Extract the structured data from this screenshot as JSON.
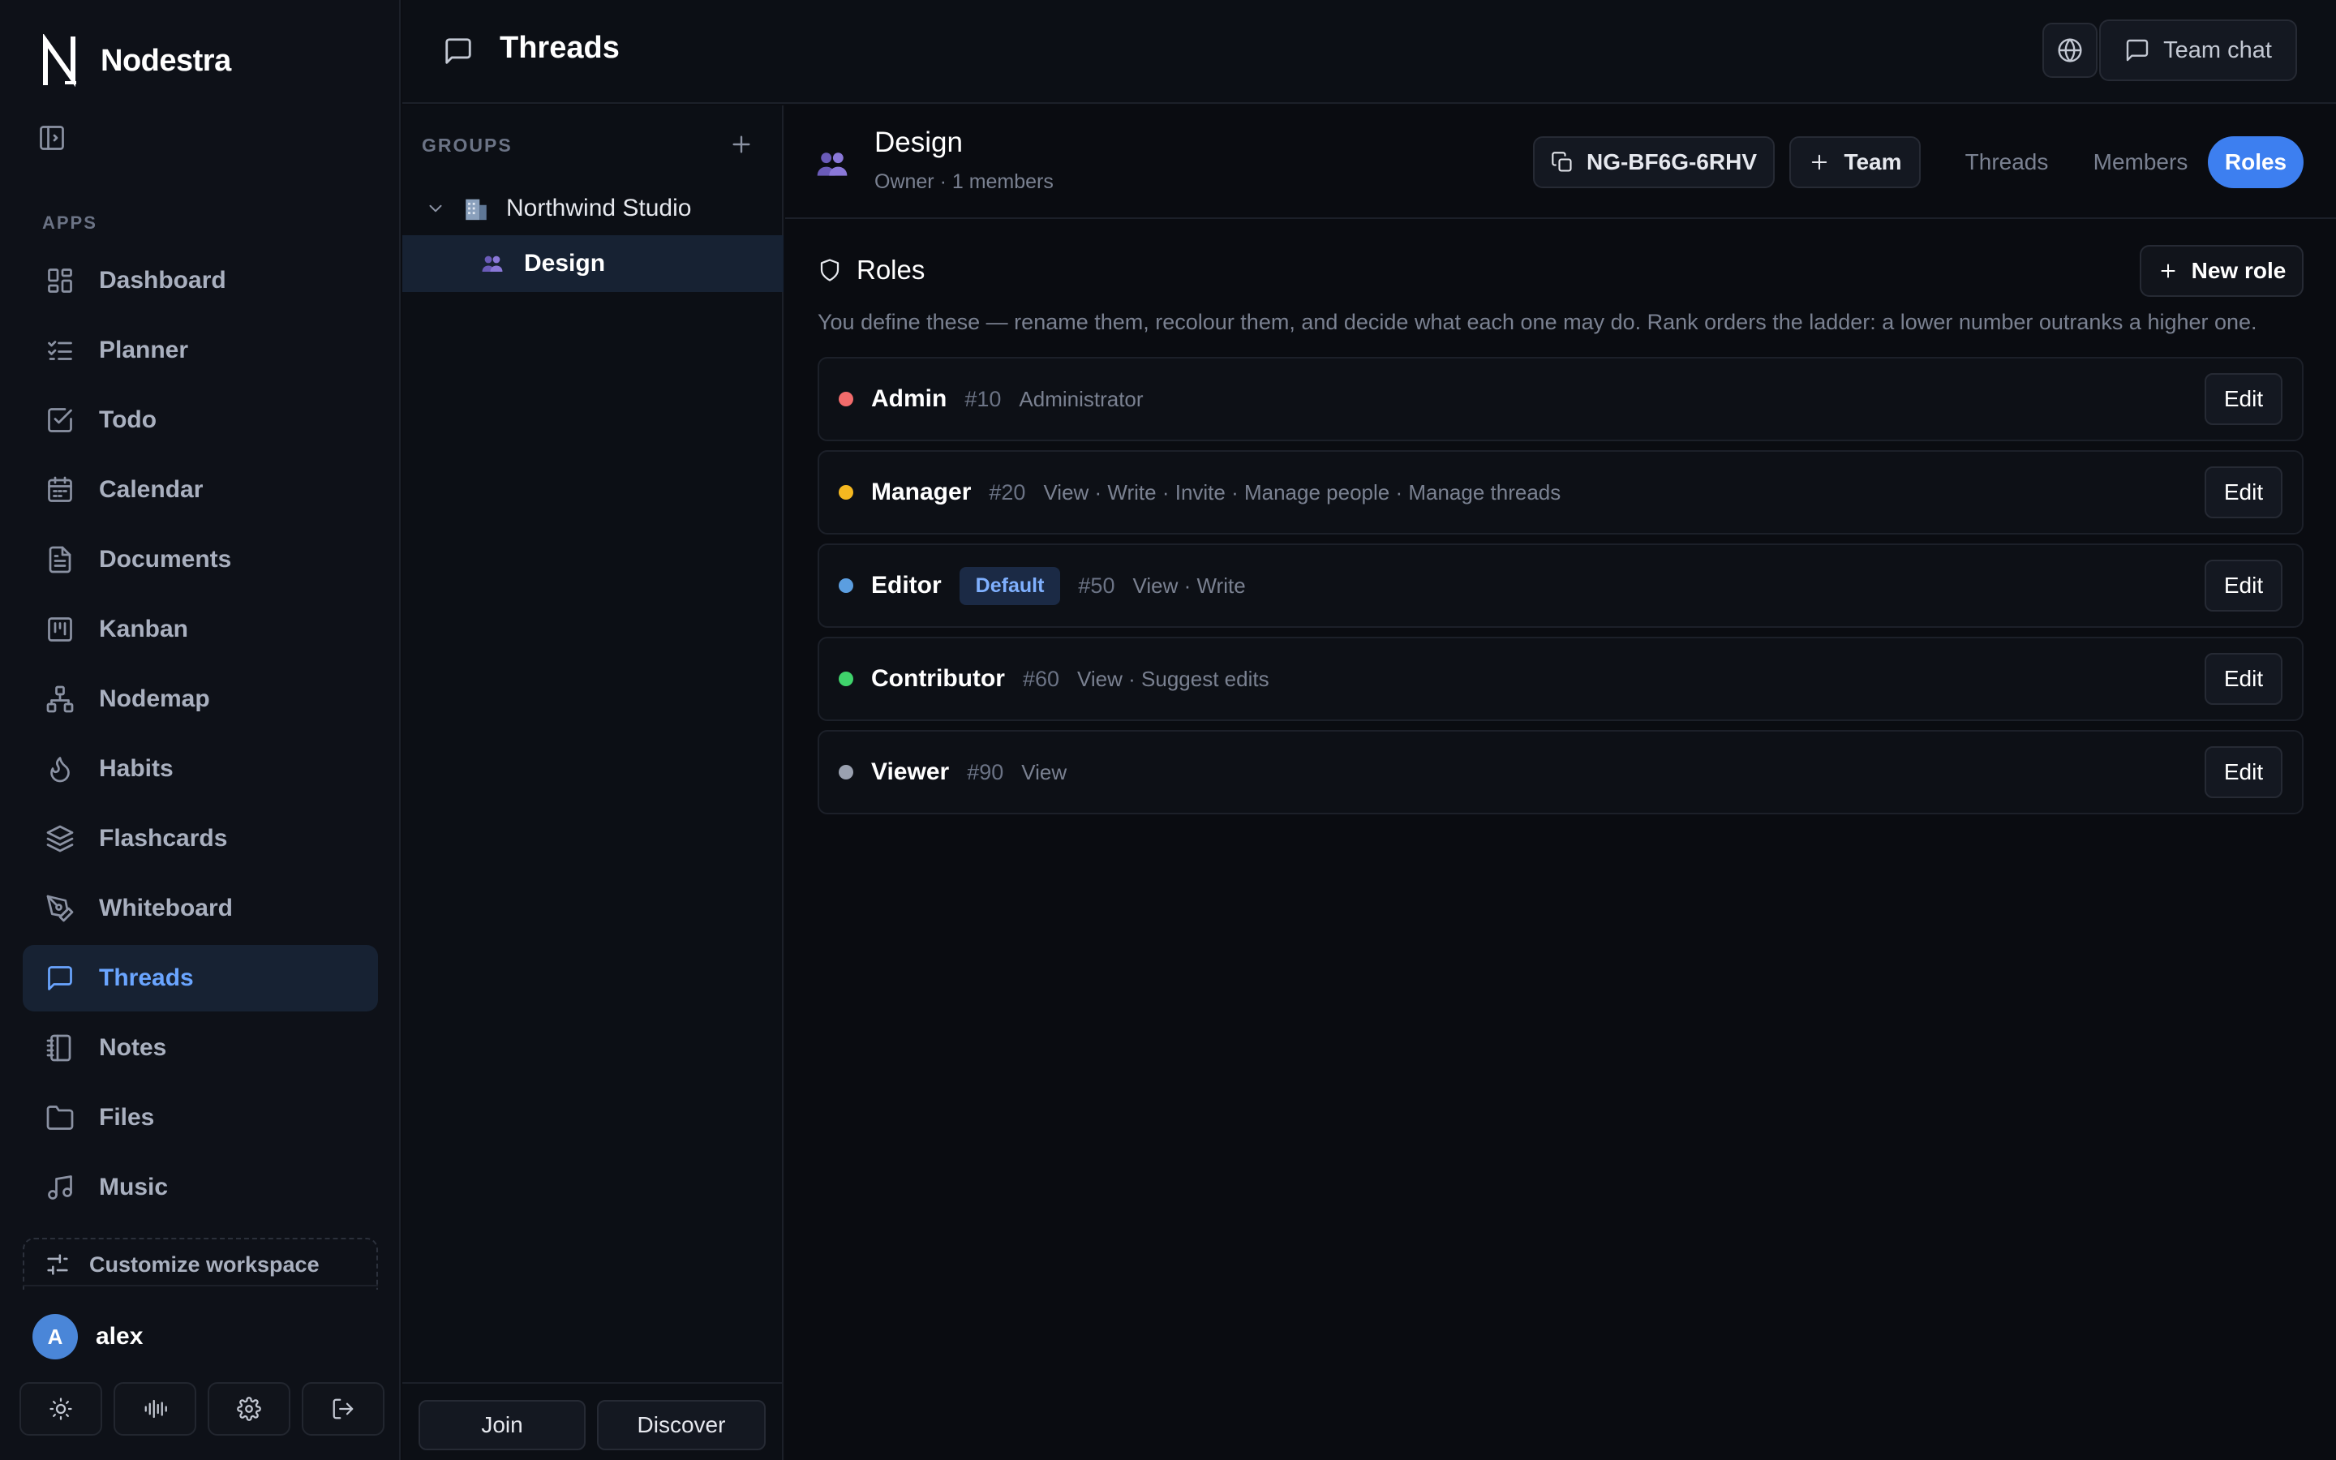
{
  "app": {
    "name": "Nodestra"
  },
  "sidebar": {
    "section_label": "APPS",
    "items": [
      {
        "label": "Dashboard",
        "icon": "dashboard-icon"
      },
      {
        "label": "Planner",
        "icon": "list-check-icon"
      },
      {
        "label": "Todo",
        "icon": "checkbox-icon"
      },
      {
        "label": "Calendar",
        "icon": "calendar-icon"
      },
      {
        "label": "Documents",
        "icon": "document-icon"
      },
      {
        "label": "Kanban",
        "icon": "kanban-icon"
      },
      {
        "label": "Nodemap",
        "icon": "nodemap-icon"
      },
      {
        "label": "Habits",
        "icon": "flame-icon"
      },
      {
        "label": "Flashcards",
        "icon": "layers-icon"
      },
      {
        "label": "Whiteboard",
        "icon": "pen-tool-icon"
      },
      {
        "label": "Threads",
        "icon": "message-icon",
        "active": true
      },
      {
        "label": "Notes",
        "icon": "notebook-icon"
      },
      {
        "label": "Files",
        "icon": "folder-icon"
      },
      {
        "label": "Music",
        "icon": "music-icon"
      }
    ],
    "customize_label": "Customize workspace",
    "user": {
      "initial": "A",
      "name": "alex"
    },
    "footer_buttons": [
      "sun-icon",
      "audio-waveform-icon",
      "gear-icon",
      "logout-icon"
    ]
  },
  "topbar": {
    "title": "Threads",
    "team_chat_label": "Team chat"
  },
  "groups": {
    "label": "GROUPS",
    "org": "Northwind Studio",
    "group": "Design",
    "join_label": "Join",
    "discover_label": "Discover"
  },
  "group_header": {
    "name": "Design",
    "subtitle": "Owner · 1 members",
    "invite_code": "NG-BF6G-6RHV",
    "team_label": "Team",
    "tabs": [
      "Threads",
      "Members",
      "Roles"
    ],
    "active_tab": "Roles"
  },
  "roles": {
    "title": "Roles",
    "new_role_label": "New role",
    "description": "You define these — rename them, recolour them, and decide what each one may do. Rank orders the ladder: a lower number outranks a higher one.",
    "edit_label": "Edit",
    "items": [
      {
        "name": "Admin",
        "color": "#f26b6b",
        "badge": "",
        "rank": "#10",
        "permissions": "Administrator"
      },
      {
        "name": "Manager",
        "color": "#f5b820",
        "badge": "",
        "rank": "#20",
        "permissions": "View · Write · Invite · Manage people · Manage threads"
      },
      {
        "name": "Editor",
        "color": "#5b9ee0",
        "badge": "Default",
        "rank": "#50",
        "permissions": "View · Write"
      },
      {
        "name": "Contributor",
        "color": "#3fd36b",
        "badge": "",
        "rank": "#60",
        "permissions": "View · Suggest edits"
      },
      {
        "name": "Viewer",
        "color": "#9aa1b0",
        "badge": "",
        "rank": "#90",
        "permissions": "View"
      }
    ]
  },
  "colors": {
    "accent": "#3d7ff0",
    "active_nav": "#6aa5ff",
    "background": "#0b0d12"
  }
}
